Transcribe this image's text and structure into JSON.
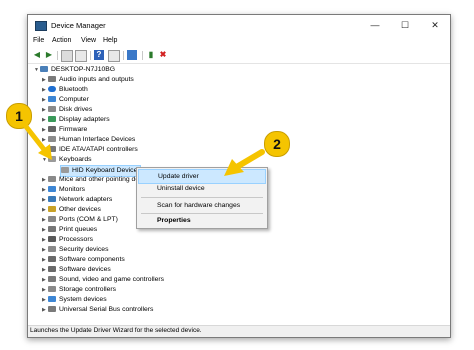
{
  "window": {
    "title": "Device Manager",
    "controls": {
      "minimize": "—",
      "maximize": "☐",
      "close": "✕"
    }
  },
  "menu": [
    "File",
    "Action",
    "View",
    "Help"
  ],
  "tree": {
    "root": "DESKTOP-N7J10BG",
    "categories": [
      {
        "label": "Audio inputs and outputs",
        "icon": "speaker-icon"
      },
      {
        "label": "Bluetooth",
        "icon": "bluetooth-icon"
      },
      {
        "label": "Computer",
        "icon": "computer-icon"
      },
      {
        "label": "Disk drives",
        "icon": "disk-icon"
      },
      {
        "label": "Display adapters",
        "icon": "display-icon"
      },
      {
        "label": "Firmware",
        "icon": "firmware-icon"
      },
      {
        "label": "Human Interface Devices",
        "icon": "hid-icon"
      },
      {
        "label": "IDE ATA/ATAPI controllers",
        "icon": "ide-icon"
      },
      {
        "label": "Keyboards",
        "icon": "keyboard-icon",
        "expanded": true,
        "children": [
          {
            "label": "HID Keyboard Device",
            "selected": true
          }
        ]
      },
      {
        "label": "Mice and other pointing devices",
        "icon": "mouse-icon"
      },
      {
        "label": "Monitors",
        "icon": "monitor-icon"
      },
      {
        "label": "Network adapters",
        "icon": "network-icon"
      },
      {
        "label": "Other devices",
        "icon": "other-icon"
      },
      {
        "label": "Ports (COM & LPT)",
        "icon": "port-icon"
      },
      {
        "label": "Print queues",
        "icon": "printer-icon"
      },
      {
        "label": "Processors",
        "icon": "processor-icon"
      },
      {
        "label": "Security devices",
        "icon": "security-icon"
      },
      {
        "label": "Software components",
        "icon": "software-icon"
      },
      {
        "label": "Software devices",
        "icon": "software-icon"
      },
      {
        "label": "Sound, video and game controllers",
        "icon": "sound-icon"
      },
      {
        "label": "Storage controllers",
        "icon": "storage-icon"
      },
      {
        "label": "System devices",
        "icon": "system-icon"
      },
      {
        "label": "Universal Serial Bus controllers",
        "icon": "usb-icon"
      }
    ]
  },
  "context_menu": {
    "items": [
      "Update driver",
      "Uninstall device",
      "Scan for hardware changes",
      "Properties"
    ],
    "highlighted": "Update driver"
  },
  "status": "Launches the Update Driver Wizard for the selected device.",
  "callouts": [
    "1",
    "2"
  ],
  "colors": {
    "callout": "#f5c400",
    "highlight": "#cce8ff",
    "selection": "#cce8ff"
  }
}
